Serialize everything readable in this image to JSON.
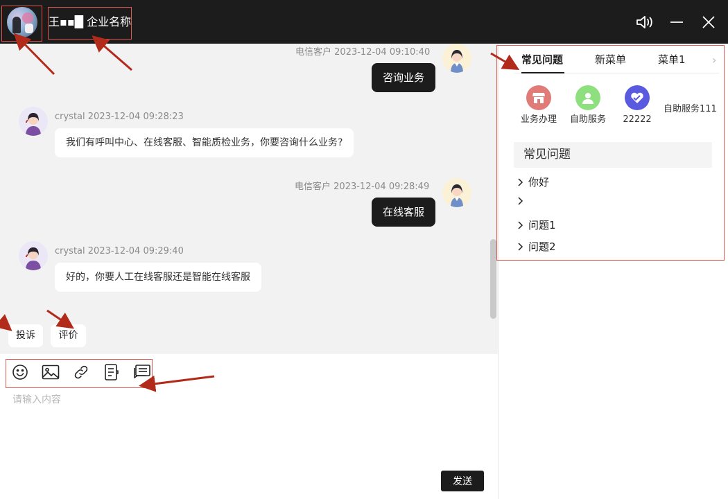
{
  "header": {
    "company_name": "王▪▪█ 企业名称",
    "icons": [
      "speaker-icon",
      "minimize-icon",
      "close-icon"
    ]
  },
  "messages": [
    {
      "side": "right",
      "sender": "电信客户",
      "time": "2023-12-04 09:10:40",
      "text": "咨询业务"
    },
    {
      "side": "left",
      "sender": "crystal",
      "time": "2023-12-04 09:28:23",
      "text": "我们有呼叫中心、在线客服、智能质检业务，你要咨询什么业务?"
    },
    {
      "side": "right",
      "sender": "电信客户",
      "time": "2023-12-04 09:28:49",
      "text": "在线客服"
    },
    {
      "side": "left",
      "sender": "crystal",
      "time": "2023-12-04 09:29:40",
      "text": "好的，你要人工在线客服还是智能在线客服"
    }
  ],
  "quick_actions": [
    "投诉",
    "评价"
  ],
  "toolbar": [
    "emoji-icon",
    "image-icon",
    "link-icon",
    "ticket-icon",
    "quick-reply-icon"
  ],
  "input": {
    "placeholder": "请输入内容",
    "value": ""
  },
  "send_label": "发送",
  "right_panel": {
    "tabs": [
      {
        "label": "常见问题",
        "active": true
      },
      {
        "label": "新菜单",
        "active": false
      },
      {
        "label": "菜单1",
        "active": false
      }
    ],
    "services": [
      {
        "label": "业务办理",
        "color": "#e07b78",
        "icon": "shop-icon"
      },
      {
        "label": "自助服务",
        "color": "#8ee07e",
        "icon": "user-icon"
      },
      {
        "label": "22222",
        "color": "#5a5ae0",
        "icon": "heart-icon"
      },
      {
        "label": "自助服务111"
      }
    ],
    "faq_title": "常见问题",
    "faq_items": [
      "你好",
      "",
      "问题1",
      "问题2"
    ]
  },
  "colors": {
    "header_bg": "#1c1c1c",
    "annotation": "#e05a4f",
    "accent_dark": "#1c1c1c"
  }
}
